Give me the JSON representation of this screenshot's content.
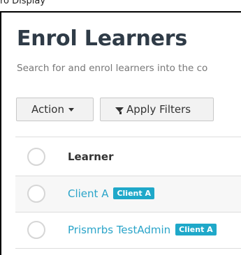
{
  "top_partial_text": "ro Display",
  "page": {
    "title": "Enrol Learners",
    "subtitle": "Search for and enrol learners into the co"
  },
  "toolbar": {
    "action_label": "Action",
    "filter_label": "Apply Filters"
  },
  "table": {
    "header": {
      "learner": "Learner"
    },
    "rows": [
      {
        "name": "Client A",
        "badge": "Client A"
      },
      {
        "name": "Prismrbs TestAdmin",
        "badge": "Client A"
      }
    ]
  },
  "colors": {
    "link": "#2aa4c9",
    "badge": "#1fa8c9",
    "title": "#2f3b47"
  }
}
